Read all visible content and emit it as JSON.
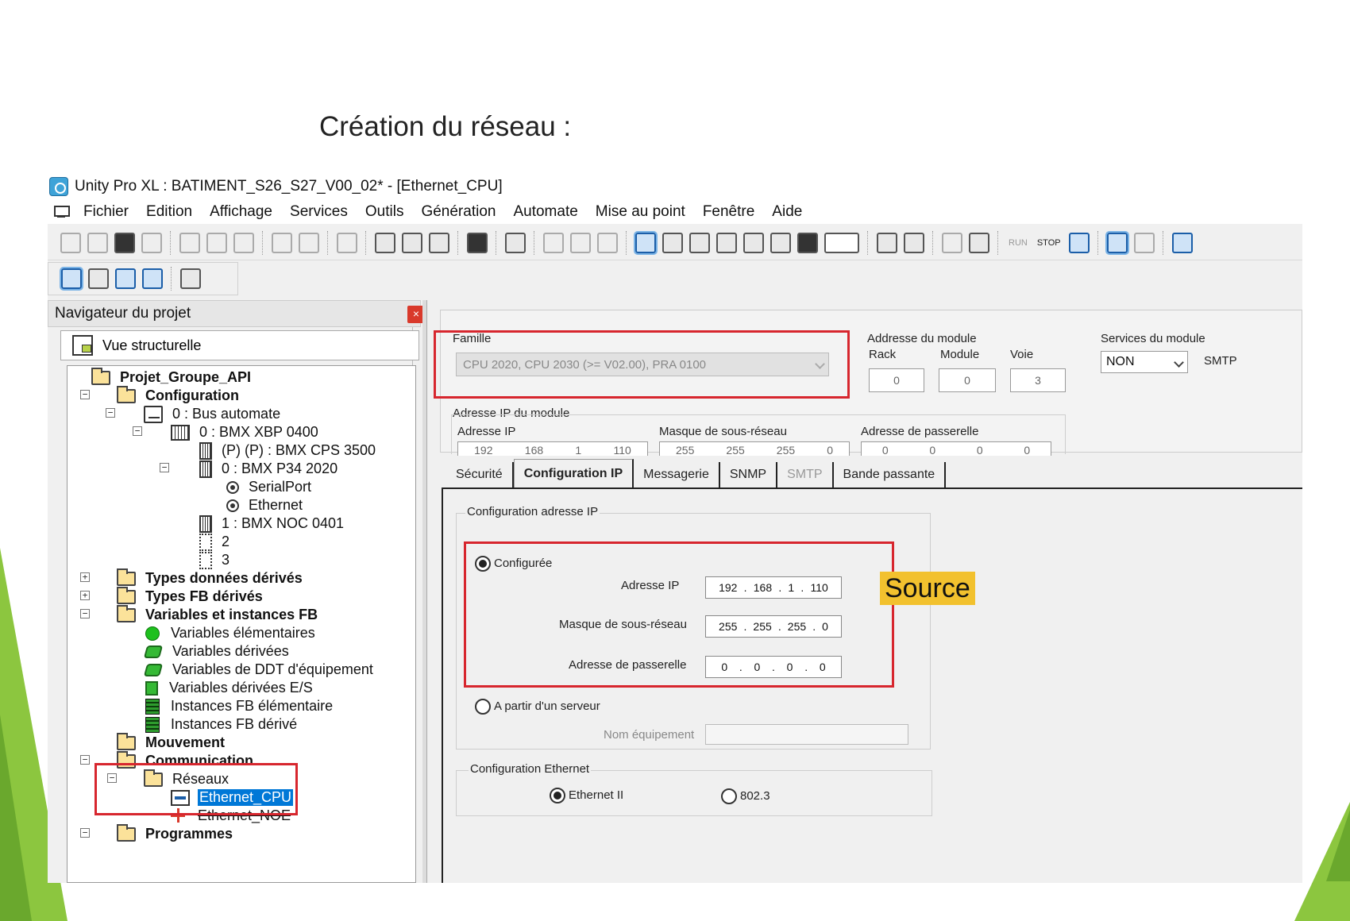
{
  "slide": {
    "title": "Création du réseau :",
    "source_label": "Source"
  },
  "app": {
    "window_title": "Unity Pro XL :  BATIMENT_S26_S27_V00_02* - [Ethernet_CPU]",
    "menu": [
      "Fichier",
      "Edition",
      "Affichage",
      "Services",
      "Outils",
      "Génération",
      "Automate",
      "Mise au point",
      "Fenêtre",
      "Aide"
    ],
    "toolbar": {
      "run_label": "RUN",
      "stop_label": "STOP",
      "combo_value": ";"
    },
    "colors": {
      "highlight_red": "#d7262e",
      "selection_blue": "#0078d7",
      "source_bg": "#f2c12e",
      "accent_green": "#8cc63f"
    }
  },
  "navigator": {
    "title": "Navigateur du projet",
    "close_label": "×",
    "view_label": "Vue structurelle",
    "tree": {
      "root": "Projet_Groupe_API",
      "configuration": "Configuration",
      "bus": "0 : Bus automate",
      "rack": "0 : BMX XBP 0400",
      "cps": "(P) (P) : BMX CPS 3500",
      "cpu": "0 : BMX P34 2020",
      "serial": "SerialPort",
      "ethernet": "Ethernet",
      "noc": "1 : BMX NOC 0401",
      "slot2": "2",
      "slot3": "3",
      "types_donnees": "Types données dérivés",
      "types_fb": "Types FB dérivés",
      "variables": "Variables et instances FB",
      "var_elem": "Variables élémentaires",
      "var_deriv": "Variables dérivées",
      "var_ddt": "Variables de DDT d'équipement",
      "var_es": "Variables dérivées E/S",
      "inst_elem": "Instances FB élémentaire",
      "inst_deriv": "Instances FB dérivé",
      "mouvement": "Mouvement",
      "communication": "Communication",
      "reseaux": "Réseaux",
      "eth_cpu": "Ethernet_CPU",
      "eth_noe": "Ethernet_NOE",
      "programmes": "Programmes"
    }
  },
  "config": {
    "famille_label": "Famille",
    "famille_value": "CPU 2020, CPU 2030 (>= V02.00), PRA 0100",
    "module_address_label": "Addresse du module",
    "rack_label": "Rack",
    "module_label": "Module",
    "voie_label": "Voie",
    "rack_value": "0",
    "module_value": "0",
    "voie_value": "3",
    "services_label": "Services du module",
    "services_value": "NON",
    "smtp_label": "SMTP",
    "ip_module_label": "Adresse IP du module",
    "ip_label": "Adresse IP",
    "mask_label": "Masque de sous-réseau",
    "gateway_label": "Adresse de passerelle",
    "ip_values": [
      "192",
      "168",
      "1",
      "110"
    ],
    "mask_values": [
      "255",
      "255",
      "255",
      "0"
    ],
    "gateway_values": [
      "0",
      "0",
      "0",
      "0"
    ]
  },
  "tabs": [
    {
      "label": "Sécurité",
      "active": false,
      "disabled": false
    },
    {
      "label": "Configuration IP",
      "active": true,
      "disabled": false
    },
    {
      "label": "Messagerie",
      "active": false,
      "disabled": false
    },
    {
      "label": "SNMP",
      "active": false,
      "disabled": false
    },
    {
      "label": "SMTP",
      "active": false,
      "disabled": true
    },
    {
      "label": "Bande passante",
      "active": false,
      "disabled": false
    }
  ],
  "ipconfig": {
    "group_label": "Configuration adresse IP",
    "configured_label": "Configurée",
    "configured_selected": true,
    "ip_label": "Adresse IP",
    "mask_label": "Masque de sous-réseau",
    "gateway_label": "Adresse de passerelle",
    "ip": [
      "192",
      "168",
      "1",
      "110"
    ],
    "mask": [
      "255",
      "255",
      "255",
      "0"
    ],
    "gateway": [
      "0",
      "0",
      "0",
      "0"
    ],
    "server_label": "A partir d'un serveur",
    "device_name_label": "Nom équipement",
    "device_name_value": "",
    "eth_group_label": "Configuration Ethernet",
    "eth2_label": "Ethernet II",
    "ieee_label": "802.3",
    "eth2_selected": true
  }
}
